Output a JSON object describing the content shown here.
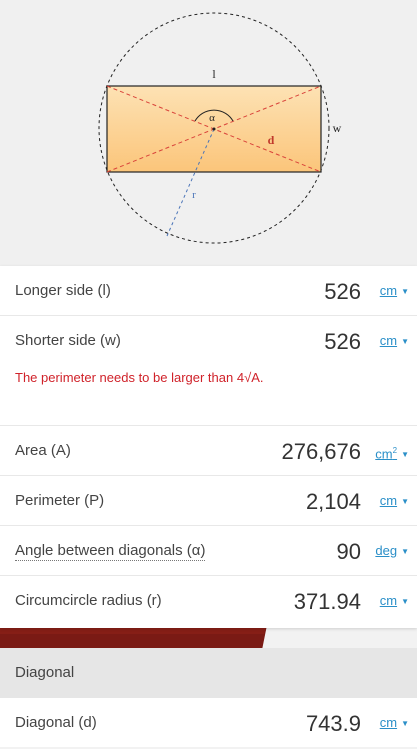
{
  "diagram": {
    "label_l": "l",
    "label_w": "w",
    "label_d": "d",
    "label_r": "r",
    "label_alpha": "α"
  },
  "fields": [
    {
      "label": "Longer side (l)",
      "value": "526",
      "unit": "cm"
    },
    {
      "label": "Shorter side (w)",
      "value": "526",
      "unit": "cm"
    },
    {
      "label": "Area (A)",
      "value": "276,676",
      "unit": "cm",
      "unit_sup": "2"
    },
    {
      "label": "Perimeter (P)",
      "value": "2,104",
      "unit": "cm"
    },
    {
      "label": "Angle between diagonals (α)",
      "value": "90",
      "unit": "deg"
    },
    {
      "label": "Circumcircle radius (r)",
      "value": "371.94",
      "unit": "cm"
    }
  ],
  "error_message": "The perimeter needs to be larger than 4√A.",
  "section": {
    "title": "Diagonal",
    "field": {
      "label": "Diagonal (d)",
      "value": "743.9",
      "unit": "cm"
    }
  },
  "colors": {
    "rect_fill": "#fcd08e",
    "diagonal": "#d9433a",
    "radius": "#4a74b8",
    "link": "#2a8fc8",
    "error": "#d0222a",
    "band": "#7a1a14"
  },
  "icons": {
    "dropdown": "dropdown-triangle-icon"
  }
}
